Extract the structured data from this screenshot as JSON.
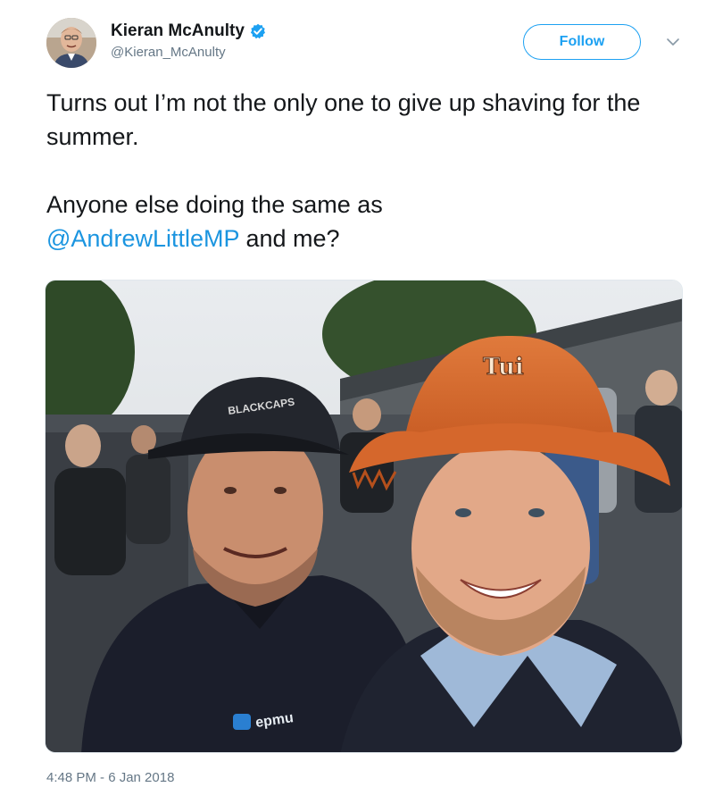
{
  "user": {
    "display_name": "Kieran McAnulty",
    "handle": "@Kieran_McAnulty",
    "verified": true
  },
  "follow_label": "Follow",
  "tweet": {
    "line1": "Turns out I’m not the only one to give up shaving for the summer.",
    "line2_mention": "Anyone else doing the same as",
    "mention": "@AndrewLittleMP",
    "line2_suffix": " and me?"
  },
  "photo": {
    "hat_text": "Tui",
    "cap_text": "BLACKCAPS",
    "jacket_logo_text": "epmu"
  },
  "timestamp": "4:48 PM - 6 Jan 2018",
  "colors": {
    "accent": "#1da1f2",
    "link": "#1b95e0",
    "secondary_text": "#657786",
    "primary_text": "#14171a"
  },
  "icons": [
    "verified-badge-icon",
    "chevron-down-icon"
  ]
}
